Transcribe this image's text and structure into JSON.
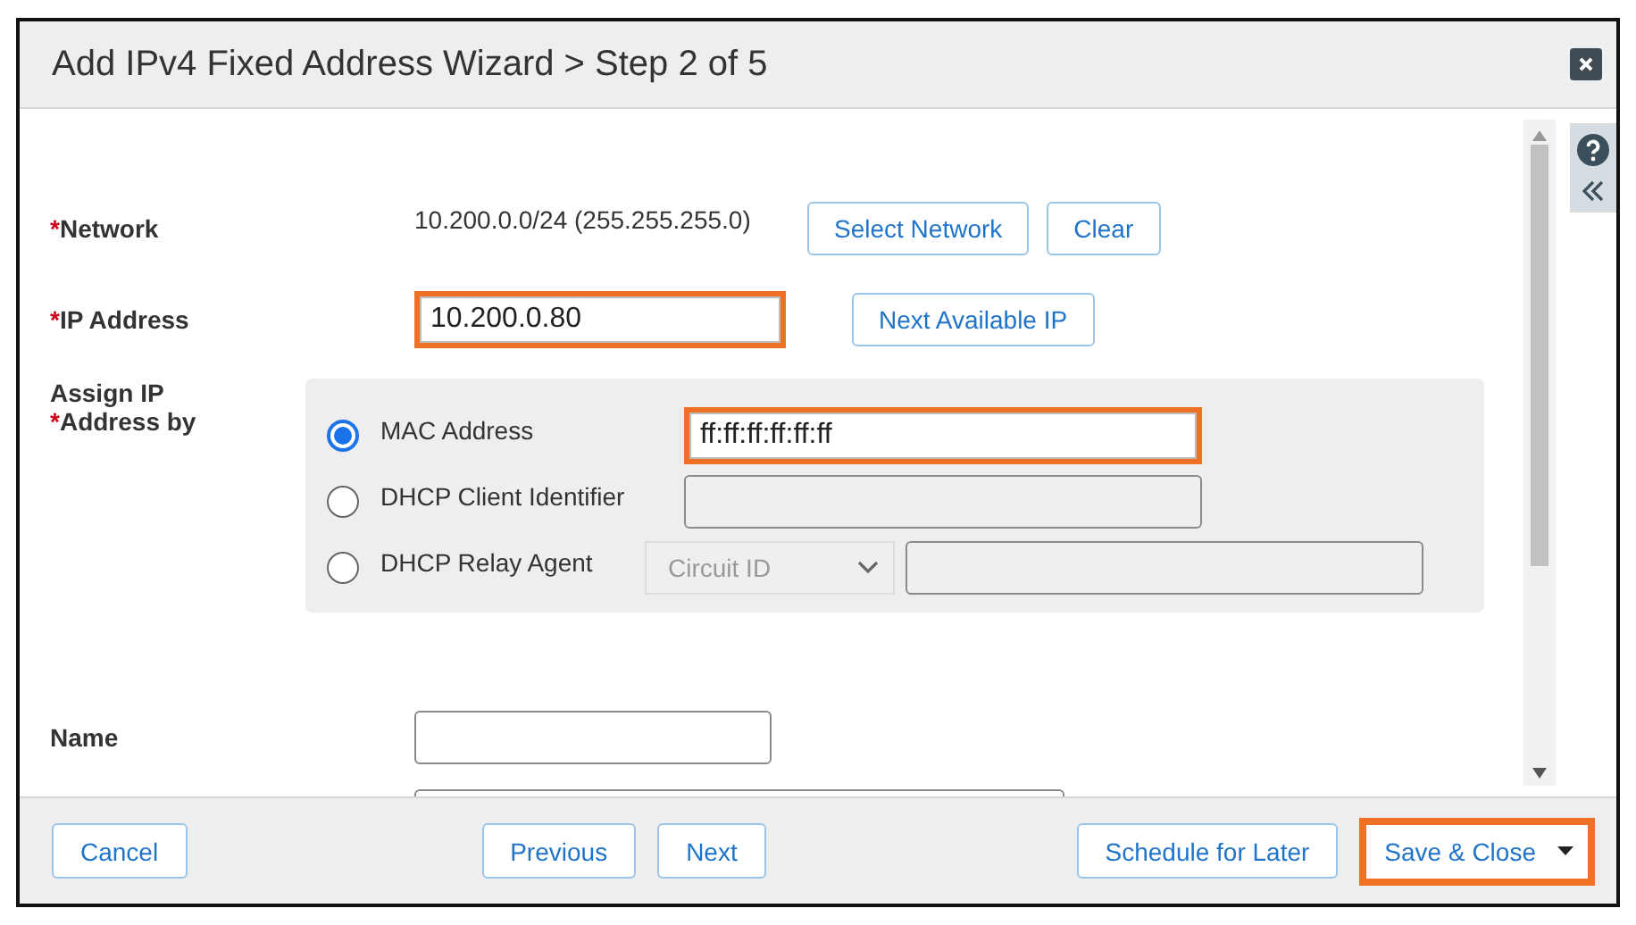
{
  "dialog": {
    "title": "Add IPv4 Fixed Address Wizard > Step 2 of 5"
  },
  "network": {
    "marker": "*",
    "label": "Network",
    "value": "10.200.0.0/24 (255.255.255.0)",
    "buttons": [
      "Select Network",
      "Clear"
    ]
  },
  "ip_address": {
    "marker": "*",
    "label": "IP Address",
    "value": "10.200.0.80",
    "highlighted": true,
    "button": "Next Available IP"
  },
  "assign_by": {
    "label_first": "Assign IP",
    "marker": "*",
    "label_second": "Address by",
    "options": [
      {
        "label": "MAC Address",
        "selected": true,
        "kind": "text",
        "value": "ff:ff:ff:ff:ff:ff",
        "highlighted": true,
        "disabled": false
      },
      {
        "label": "DHCP Client Identifier",
        "selected": false,
        "kind": "text",
        "highlighted": false,
        "disabled": true
      },
      {
        "label": "DHCP Relay Agent",
        "selected": false,
        "kind": "select-text",
        "select_value": "Circuit ID",
        "highlighted": false,
        "disabled": true
      }
    ]
  },
  "name": {
    "label": "Name"
  },
  "footer": {
    "left": [
      {
        "label": "Cancel",
        "kind": "plain",
        "highlighted": false
      }
    ],
    "center": [
      {
        "label": "Previous",
        "kind": "plain",
        "highlighted": false
      },
      {
        "label": "Next",
        "kind": "plain",
        "highlighted": false
      }
    ],
    "right": [
      {
        "label": "Schedule for Later",
        "kind": "plain",
        "highlighted": false
      },
      {
        "label": "Save & Close",
        "kind": "split",
        "highlighted": true
      }
    ]
  }
}
